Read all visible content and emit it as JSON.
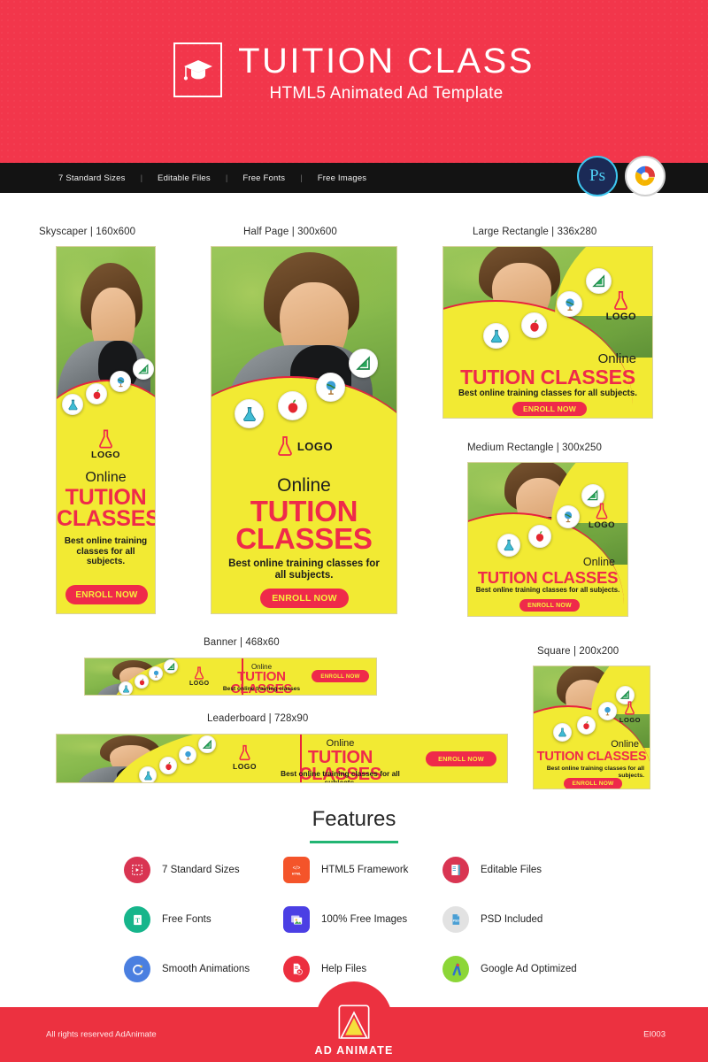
{
  "header": {
    "title": "TUITION CLASS",
    "subtitle": "HTML5 Animated Ad Template",
    "logo_icon": "graduation-cap-icon"
  },
  "featurebar": {
    "items": [
      "7 Standard Sizes",
      "Editable Files",
      "Free Fonts",
      "Free Images"
    ],
    "separator": "|",
    "badges": [
      {
        "name": "photoshop-badge",
        "label": "Ps"
      },
      {
        "name": "google-web-designer-badge",
        "label": ""
      }
    ]
  },
  "ad_content": {
    "online": "Online",
    "headline_line1": "TUTION",
    "headline_line2": "CLASSES",
    "headline_single": "TUTION CLASSES",
    "desc_long": "Best online training classes for all subjects.",
    "desc_sky": "Best online training classes for all subjects.",
    "desc_short": "Best online training classes",
    "cta": "ENROLL NOW",
    "logo_text": "LOGO"
  },
  "ads": [
    {
      "name": "skyscraper",
      "label": "Skyscaper | 160x600"
    },
    {
      "name": "half-page",
      "label": "Half Page | 300x600"
    },
    {
      "name": "large-rectangle",
      "label": "Large Rectangle | 336x280"
    },
    {
      "name": "medium-rectangle",
      "label": "Medium Rectangle | 300x250"
    },
    {
      "name": "banner",
      "label": "Banner | 468x60"
    },
    {
      "name": "leaderboard",
      "label": "Leaderboard | 728x90"
    },
    {
      "name": "square",
      "label": "Square | 200x200"
    }
  ],
  "features": {
    "title": "Features",
    "items": [
      {
        "label": "7 Standard Sizes",
        "icon": "sizes-icon",
        "color": "#d93552"
      },
      {
        "label": "HTML5 Framework",
        "icon": "html5-icon",
        "color": "#f4542a"
      },
      {
        "label": "Editable Files",
        "icon": "editable-icon",
        "color": "#d93552"
      },
      {
        "label": "Free Fonts",
        "icon": "fonts-icon",
        "color": "#16b58b"
      },
      {
        "label": "100% Free Images",
        "icon": "images-icon",
        "color": "#4b3fe4"
      },
      {
        "label": "PSD Included",
        "icon": "psd-icon",
        "color": "#e2e2e2"
      },
      {
        "label": "Smooth Animations",
        "icon": "animation-icon",
        "color": "#4a7fe0"
      },
      {
        "label": "Help Files",
        "icon": "help-icon",
        "color": "#ec2f3f"
      },
      {
        "label": "Google Ad Optimized",
        "icon": "google-ads-icon",
        "color": "#8cd637"
      }
    ]
  },
  "footer": {
    "copyright": "All rights reserved AdAnimate",
    "code": "EI003",
    "brand": "AD ANIMATE"
  },
  "colors": {
    "brand_red": "#f2364b",
    "footer_red": "#ec3140",
    "ad_yellow": "#f2ea33",
    "ad_red": "#ef2a4a",
    "cta_yellow": "#f6ee3c",
    "rule_green": "#22b573",
    "bar_black": "#131313"
  }
}
